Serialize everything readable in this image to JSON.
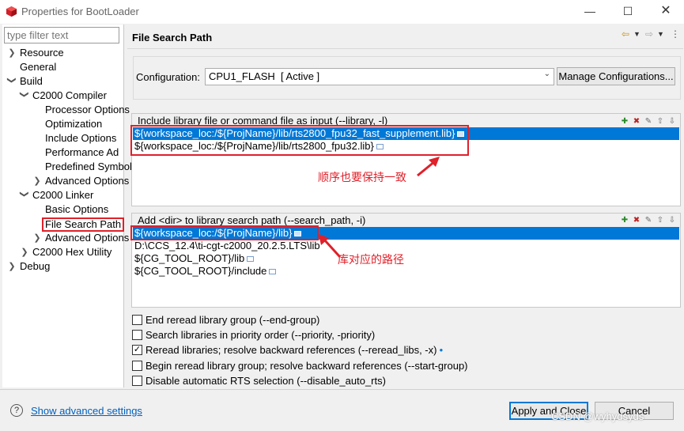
{
  "window": {
    "title": "Properties for BootLoader",
    "min_icon": "minimize-icon",
    "max_icon": "maximize-icon",
    "close_icon": "close-icon"
  },
  "left": {
    "filter_placeholder": "type filter text",
    "tree": [
      {
        "label": "Resource",
        "toggle": "collapsed"
      },
      {
        "label": "General",
        "toggle": "none"
      },
      {
        "label": "Build",
        "toggle": "expanded"
      },
      {
        "label": "C2000 Compiler",
        "toggle": "expanded"
      },
      {
        "label": "Processor Options",
        "toggle": "none"
      },
      {
        "label": "Optimization",
        "toggle": "none"
      },
      {
        "label": "Include Options",
        "toggle": "none"
      },
      {
        "label": "Performance Ad",
        "toggle": "none"
      },
      {
        "label": "Predefined Symbols",
        "toggle": "none"
      },
      {
        "label": "Advanced Options",
        "toggle": "collapsed"
      },
      {
        "label": "C2000 Linker",
        "toggle": "expanded"
      },
      {
        "label": "Basic Options",
        "toggle": "none"
      },
      {
        "label": "File Search Path",
        "toggle": "none",
        "selected": true
      },
      {
        "label": "Advanced Options",
        "toggle": "collapsed"
      },
      {
        "label": "C2000 Hex Utility",
        "toggle": "collapsed"
      },
      {
        "label": "Debug",
        "toggle": "collapsed"
      }
    ]
  },
  "main": {
    "title": "File Search Path",
    "config_label": "Configuration:",
    "config_value": "CPU1_FLASH  [ Active ]",
    "manage_button": "Manage Configurations...",
    "include_lib": {
      "header": "Include library file or command file as input (--library, -l)",
      "items": [
        "${workspace_loc:/${ProjName}/lib/rts2800_fpu32_fast_supplement.lib}",
        "${workspace_loc:/${ProjName}/lib/rts2800_fpu32.lib}"
      ],
      "selected_index": 0
    },
    "search_path": {
      "header": "Add <dir> to library search path (--search_path, -i)",
      "items": [
        "${workspace_loc:/${ProjName}/lib}",
        "D:\\CCS_12.4\\ti-cgt-c2000_20.2.5.LTS\\lib",
        "${CG_TOOL_ROOT}/lib",
        "${CG_TOOL_ROOT}/include"
      ],
      "selected_index": 0
    },
    "annotations": {
      "order_note": "顺序也要保持一致",
      "path_note": "库对应的路径"
    },
    "options": [
      {
        "label": "End reread library group (--end-group)",
        "checked": false
      },
      {
        "label": "Search libraries in priority order (--priority, -priority)",
        "checked": false
      },
      {
        "label": "Reread libraries; resolve backward references (--reread_libs, -x)",
        "checked": true
      },
      {
        "label": "Begin reread library group; resolve backward references (--start-group)",
        "checked": false
      },
      {
        "label": "Disable automatic RTS selection (--disable_auto_rts)",
        "checked": false
      }
    ]
  },
  "footer": {
    "advanced_link": "Show advanced settings",
    "apply_close": "Apply and Close",
    "cancel": "Cancel",
    "watermark": "CSDN @wyhydsyds"
  },
  "colors": {
    "selection": "#0078d7",
    "annotation_red": "#e0202a",
    "link": "#0060c0"
  }
}
